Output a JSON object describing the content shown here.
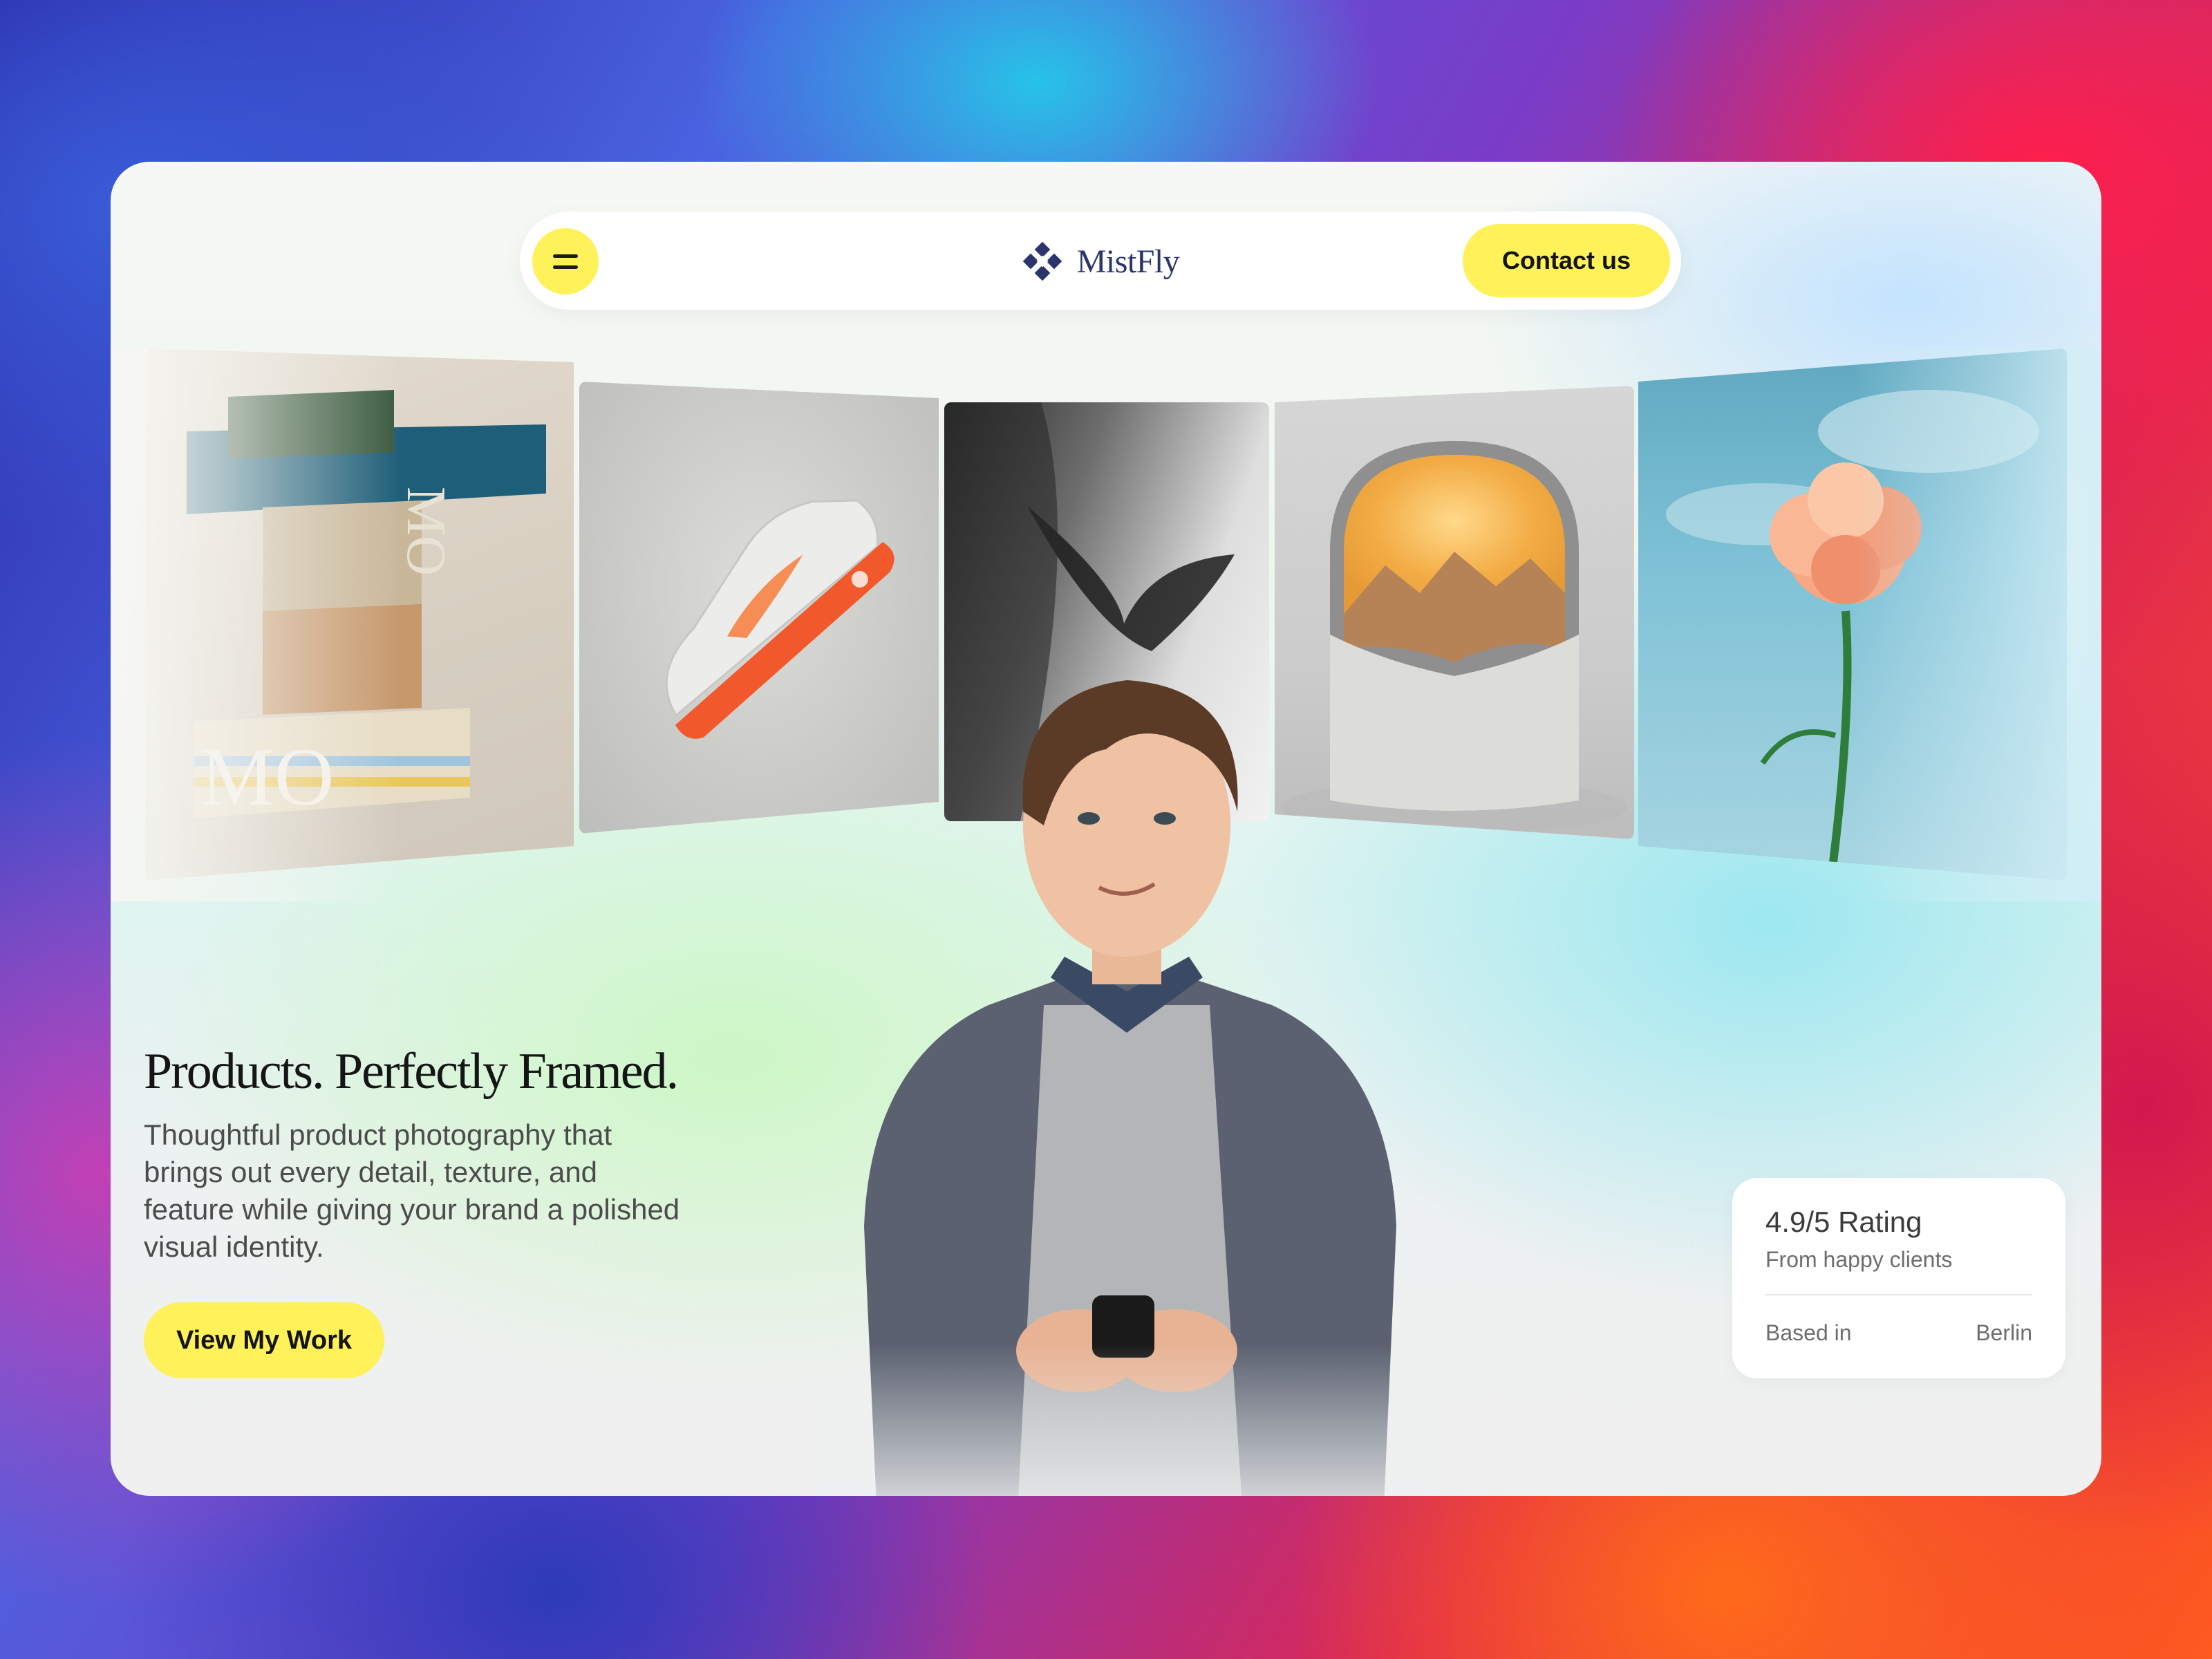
{
  "brand": {
    "name": "MistFly",
    "logo_icon": "diamond-logo-icon",
    "color": "#2b356b"
  },
  "nav": {
    "menu_icon": "menu-icon",
    "contact_label": "Contact us"
  },
  "gallery": {
    "items": [
      {
        "name": "packaging-boxes",
        "description_icon": "product-photo-boxes",
        "box_text": "MOKSI"
      },
      {
        "name": "sneaker",
        "description_icon": "product-photo-sneaker"
      },
      {
        "name": "abstract",
        "description_icon": "product-photo-abstract"
      },
      {
        "name": "lamp",
        "description_icon": "product-photo-lamp"
      },
      {
        "name": "flower",
        "description_icon": "product-photo-flower"
      }
    ]
  },
  "hero": {
    "title": "Products. Perfectly Framed.",
    "description": "Thoughtful product photography that brings out every detail, texture, and feature while giving your brand a polished visual identity.",
    "cta_label": "View My Work"
  },
  "rating": {
    "value": "4.9/5 Rating",
    "subtitle": "From happy clients",
    "based_label": "Based in",
    "based_value": "Berlin"
  },
  "colors": {
    "accent": "#fff15a",
    "text": "#151515"
  }
}
